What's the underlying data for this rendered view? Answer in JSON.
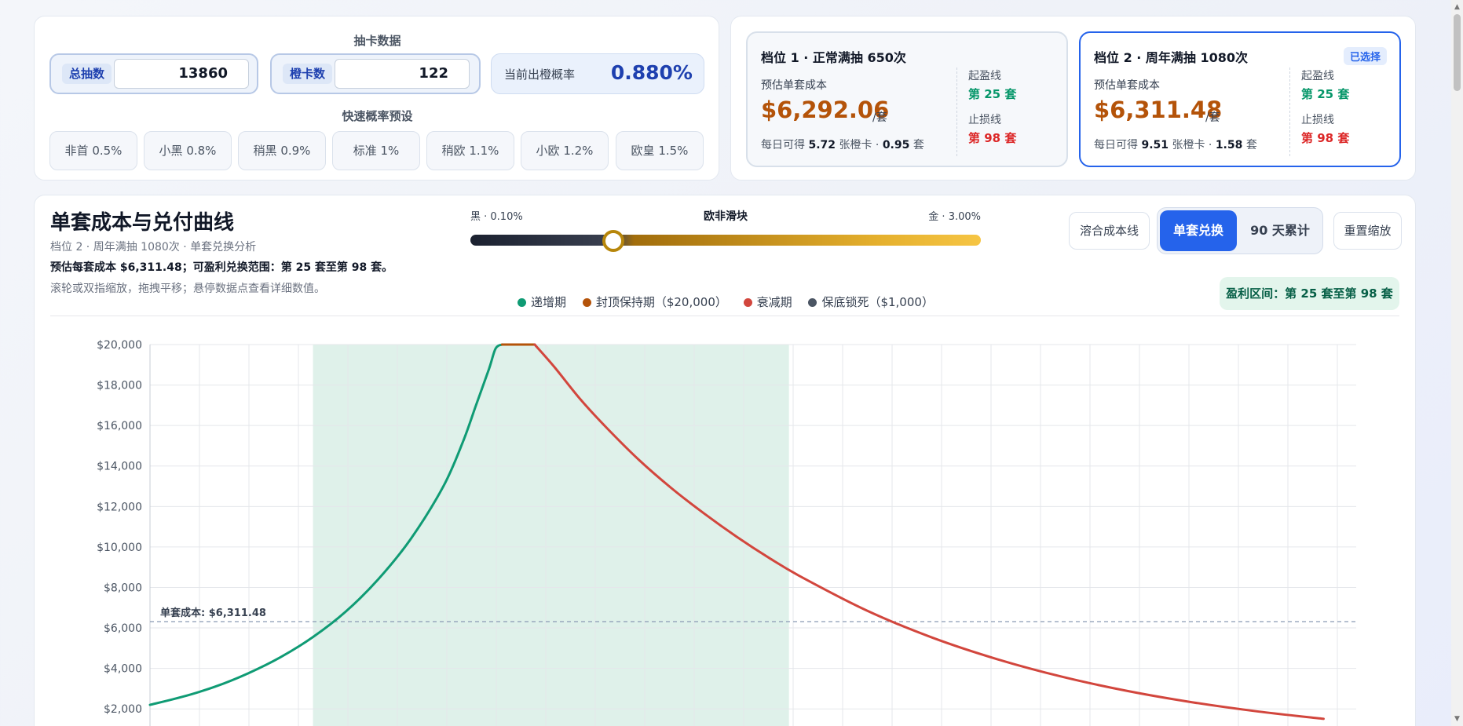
{
  "input": {
    "section_title": "抽卡数据",
    "total_label": "总抽数",
    "total_value": "13860",
    "orange_label": "橙卡数",
    "orange_value": "122",
    "rate_label": "当前出橙概率",
    "rate_value": "0.880%",
    "presets_title": "快速概率预设",
    "presets": [
      "非首 0.5%",
      "小黑 0.8%",
      "稍黑 0.9%",
      "标准 1%",
      "稍欧 1.1%",
      "小欧 1.2%",
      "欧皇 1.5%"
    ]
  },
  "tiers": [
    {
      "name": "档位 1 · 正常满抽 650次",
      "cost_label": "预估单套成本",
      "cost": "$6,292.06",
      "per": "/套",
      "daily_prefix": "每日可得",
      "daily_cards": "5.72",
      "daily_mid": "张橙卡 ·",
      "daily_sets": "0.95",
      "daily_suffix": "套",
      "start_label": "起盈线",
      "start_value": "第 25 套",
      "stop_label": "止损线",
      "stop_value": "第 98 套",
      "selected": false
    },
    {
      "name": "档位 2 · 周年满抽 1080次",
      "badge": "已选择",
      "cost_label": "预估单套成本",
      "cost": "$6,311.48",
      "per": "/套",
      "daily_prefix": "每日可得",
      "daily_cards": "9.51",
      "daily_mid": "张橙卡 ·",
      "daily_sets": "1.58",
      "daily_suffix": "套",
      "start_label": "起盈线",
      "start_value": "第 25 套",
      "stop_label": "止损线",
      "stop_value": "第 98 套",
      "selected": true
    }
  ],
  "chart_panel": {
    "title": "单套成本与兑付曲线",
    "subtitle": "档位 2 · 周年满抽 1080次 · 单套兑换分析",
    "summary": "预估每套成本 $6,311.48；可盈利兑换范围：第 25 套至第 98 套。",
    "hint": "滚轮或双指缩放，拖拽平移；悬停数据点查看详细数值。",
    "slider_left": "黑 · 0.10%",
    "slider_title": "欧非滑块",
    "slider_right": "金 · 3.00%",
    "slider_level_fraction": 0.28,
    "btn_smooth": "溶合成本线",
    "seg_on": "单套兑换",
    "seg_off": "90 天累计",
    "btn_reset": "重置缩放",
    "profit_tag": "盈利区间：第 25 套至第 98 套",
    "legend": [
      {
        "label": "递增期",
        "color": "#0f9b74"
      },
      {
        "label": "封顶保持期（$20,000）",
        "color": "#b45309"
      },
      {
        "label": "衰减期",
        "color": "#d2463d"
      },
      {
        "label": "保底锁死（$1,000）",
        "color": "#4b5563"
      }
    ]
  },
  "chart_data": {
    "type": "line",
    "y_ticks": [
      "$20,000",
      "$18,000",
      "$16,000",
      "$14,000",
      "$12,000",
      "$10,000",
      "$8,000",
      "$6,000",
      "$4,000",
      "$2,000"
    ],
    "ylim": [
      1000,
      20000
    ],
    "xlim": [
      0,
      185
    ],
    "cost_line_label": "单套成本: $6,311.48",
    "cost_line_value": 6311.48,
    "profit_range": [
      25,
      98
    ],
    "series": [
      {
        "name": "递增期",
        "color": "#0f9b74",
        "points": [
          [
            0,
            2200
          ],
          [
            5,
            2600
          ],
          [
            10,
            3100
          ],
          [
            15,
            3750
          ],
          [
            20,
            4550
          ],
          [
            25,
            5550
          ],
          [
            30,
            6800
          ],
          [
            35,
            8400
          ],
          [
            40,
            10400
          ],
          [
            45,
            13000
          ],
          [
            48,
            15200
          ],
          [
            50,
            17000
          ],
          [
            52,
            18800
          ],
          [
            53,
            19800
          ],
          [
            54,
            20000
          ]
        ]
      },
      {
        "name": "封顶保持期（$20,000）",
        "color": "#b45309",
        "points": [
          [
            54,
            20000
          ],
          [
            59,
            20000
          ]
        ]
      },
      {
        "name": "衰减期",
        "color": "#d2463d",
        "points": [
          [
            59,
            20000
          ],
          [
            62,
            18900
          ],
          [
            66,
            17300
          ],
          [
            70,
            15900
          ],
          [
            75,
            14300
          ],
          [
            80,
            12900
          ],
          [
            85,
            11650
          ],
          [
            90,
            10500
          ],
          [
            95,
            9450
          ],
          [
            100,
            8500
          ],
          [
            110,
            6850
          ],
          [
            120,
            5520
          ],
          [
            130,
            4450
          ],
          [
            140,
            3580
          ],
          [
            150,
            2880
          ],
          [
            160,
            2320
          ],
          [
            170,
            1870
          ],
          [
            180,
            1510
          ]
        ]
      }
    ]
  }
}
